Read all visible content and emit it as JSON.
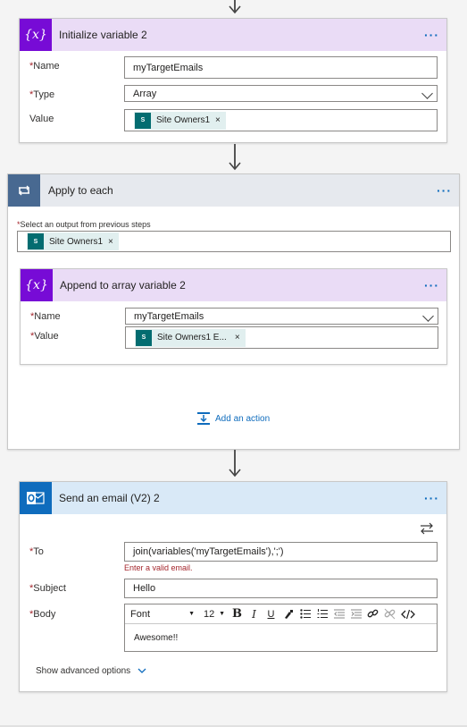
{
  "init_card": {
    "title": "Initialize variable 2",
    "name_label": "Name",
    "name_value": "myTargetEmails",
    "type_label": "Type",
    "type_value": "Array",
    "value_label": "Value",
    "value_token": "Site Owners1",
    "more": "···"
  },
  "apply_card": {
    "title": "Apply to each",
    "select_label": "Select an output from previous steps",
    "select_token": "Site Owners1",
    "more": "···",
    "add_action": "Add an action"
  },
  "append_card": {
    "title": "Append to array variable 2",
    "name_label": "Name",
    "name_value": "myTargetEmails",
    "value_label": "Value",
    "value_token": "Site Owners1 E...",
    "more": "···"
  },
  "email_card": {
    "title": "Send an email (V2) 2",
    "to_label": "To",
    "to_value": "join(variables('myTargetEmails'),';')",
    "to_error": "Enter a valid email.",
    "subject_label": "Subject",
    "subject_value": "Hello",
    "body_label": "Body",
    "font_value": "Font",
    "size_value": "12",
    "body_text": "Awesome!!",
    "advanced": "Show advanced options",
    "more": "···"
  },
  "sp_icon": "S",
  "required_mark": "*",
  "token_close": "×",
  "colors": {
    "variable_header": "#eadcf6",
    "variable_badge": "#770bd6",
    "apply_header": "#e6e9ee",
    "apply_badge": "#486991",
    "email_header": "#d9e9f7",
    "email_badge": "#0f6cbd",
    "link": "#0f6cbd",
    "error": "#a4262c"
  }
}
